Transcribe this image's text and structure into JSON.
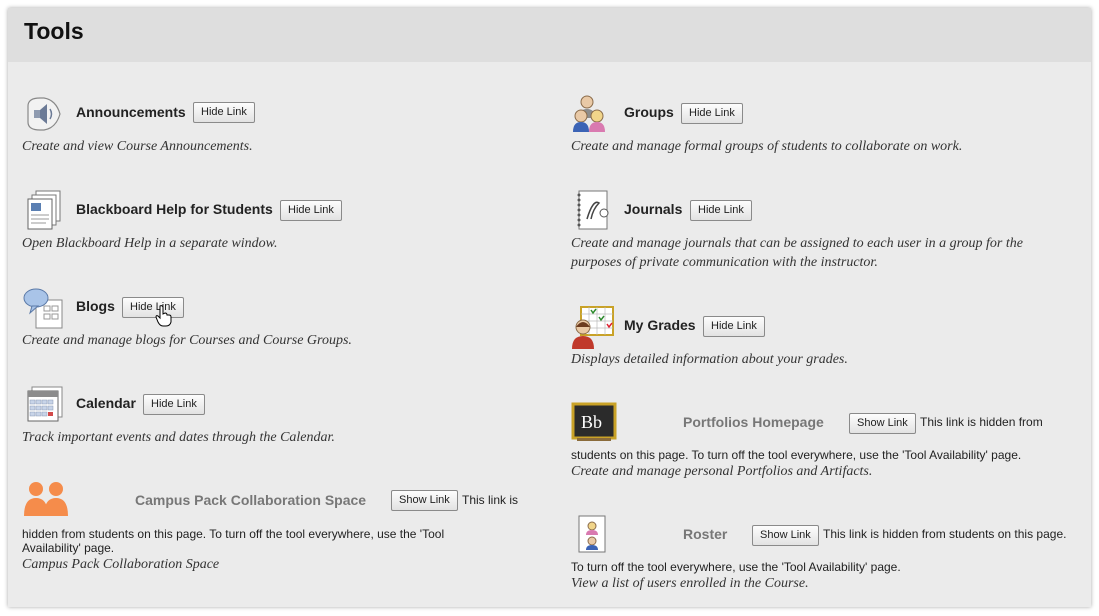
{
  "page": {
    "title": "Tools"
  },
  "tools": {
    "announcements": {
      "name": "Announcements",
      "button": "Hide Link",
      "desc": "Create and view Course Announcements."
    },
    "help": {
      "name": "Blackboard Help for Students",
      "button": "Hide Link",
      "desc": "Open Blackboard Help in a separate window."
    },
    "blogs": {
      "name": "Blogs",
      "button": "Hide Link",
      "desc": "Create and manage blogs for Courses and Course Groups."
    },
    "calendar": {
      "name": "Calendar",
      "button": "Hide Link",
      "desc": "Track important events and dates through the Calendar."
    },
    "campus": {
      "name": "Campus Pack Collaboration Space",
      "button": "Show Link",
      "note1": "This link is",
      "note2": "hidden from students on this page. To turn off the tool everywhere, use the 'Tool",
      "note3": "Availability' page.",
      "desc": "Campus Pack Collaboration Space"
    },
    "groups": {
      "name": "Groups",
      "button": "Hide Link",
      "desc": "Create and manage formal groups of students to collaborate on work."
    },
    "journals": {
      "name": "Journals",
      "button": "Hide Link",
      "desc1": "Create and manage journals that can be assigned to each user in a group for the",
      "desc2": "purposes of private communication with the instructor."
    },
    "grades": {
      "name": "My Grades",
      "button": "Hide Link",
      "desc": "Displays detailed information about your grades."
    },
    "portfolios": {
      "name": "Portfolios Homepage",
      "button": "Show Link",
      "note1": "This link is hidden from",
      "note2": "students on this page. To turn off the tool everywhere, use the 'Tool Availability' page.",
      "desc": "Create and manage personal Portfolios and Artifacts.",
      "icon_text": "Bb"
    },
    "roster": {
      "name": "Roster",
      "button": "Show Link",
      "note1": "This link is hidden from students on this page.",
      "note2": "To turn off the tool everywhere, use the 'Tool Availability' page.",
      "desc": "View a list of users enrolled in the Course."
    }
  },
  "colors": {
    "accent_orange": "#f58c4b",
    "panel_bg": "#ebebeb",
    "header_bg": "#dedede"
  }
}
